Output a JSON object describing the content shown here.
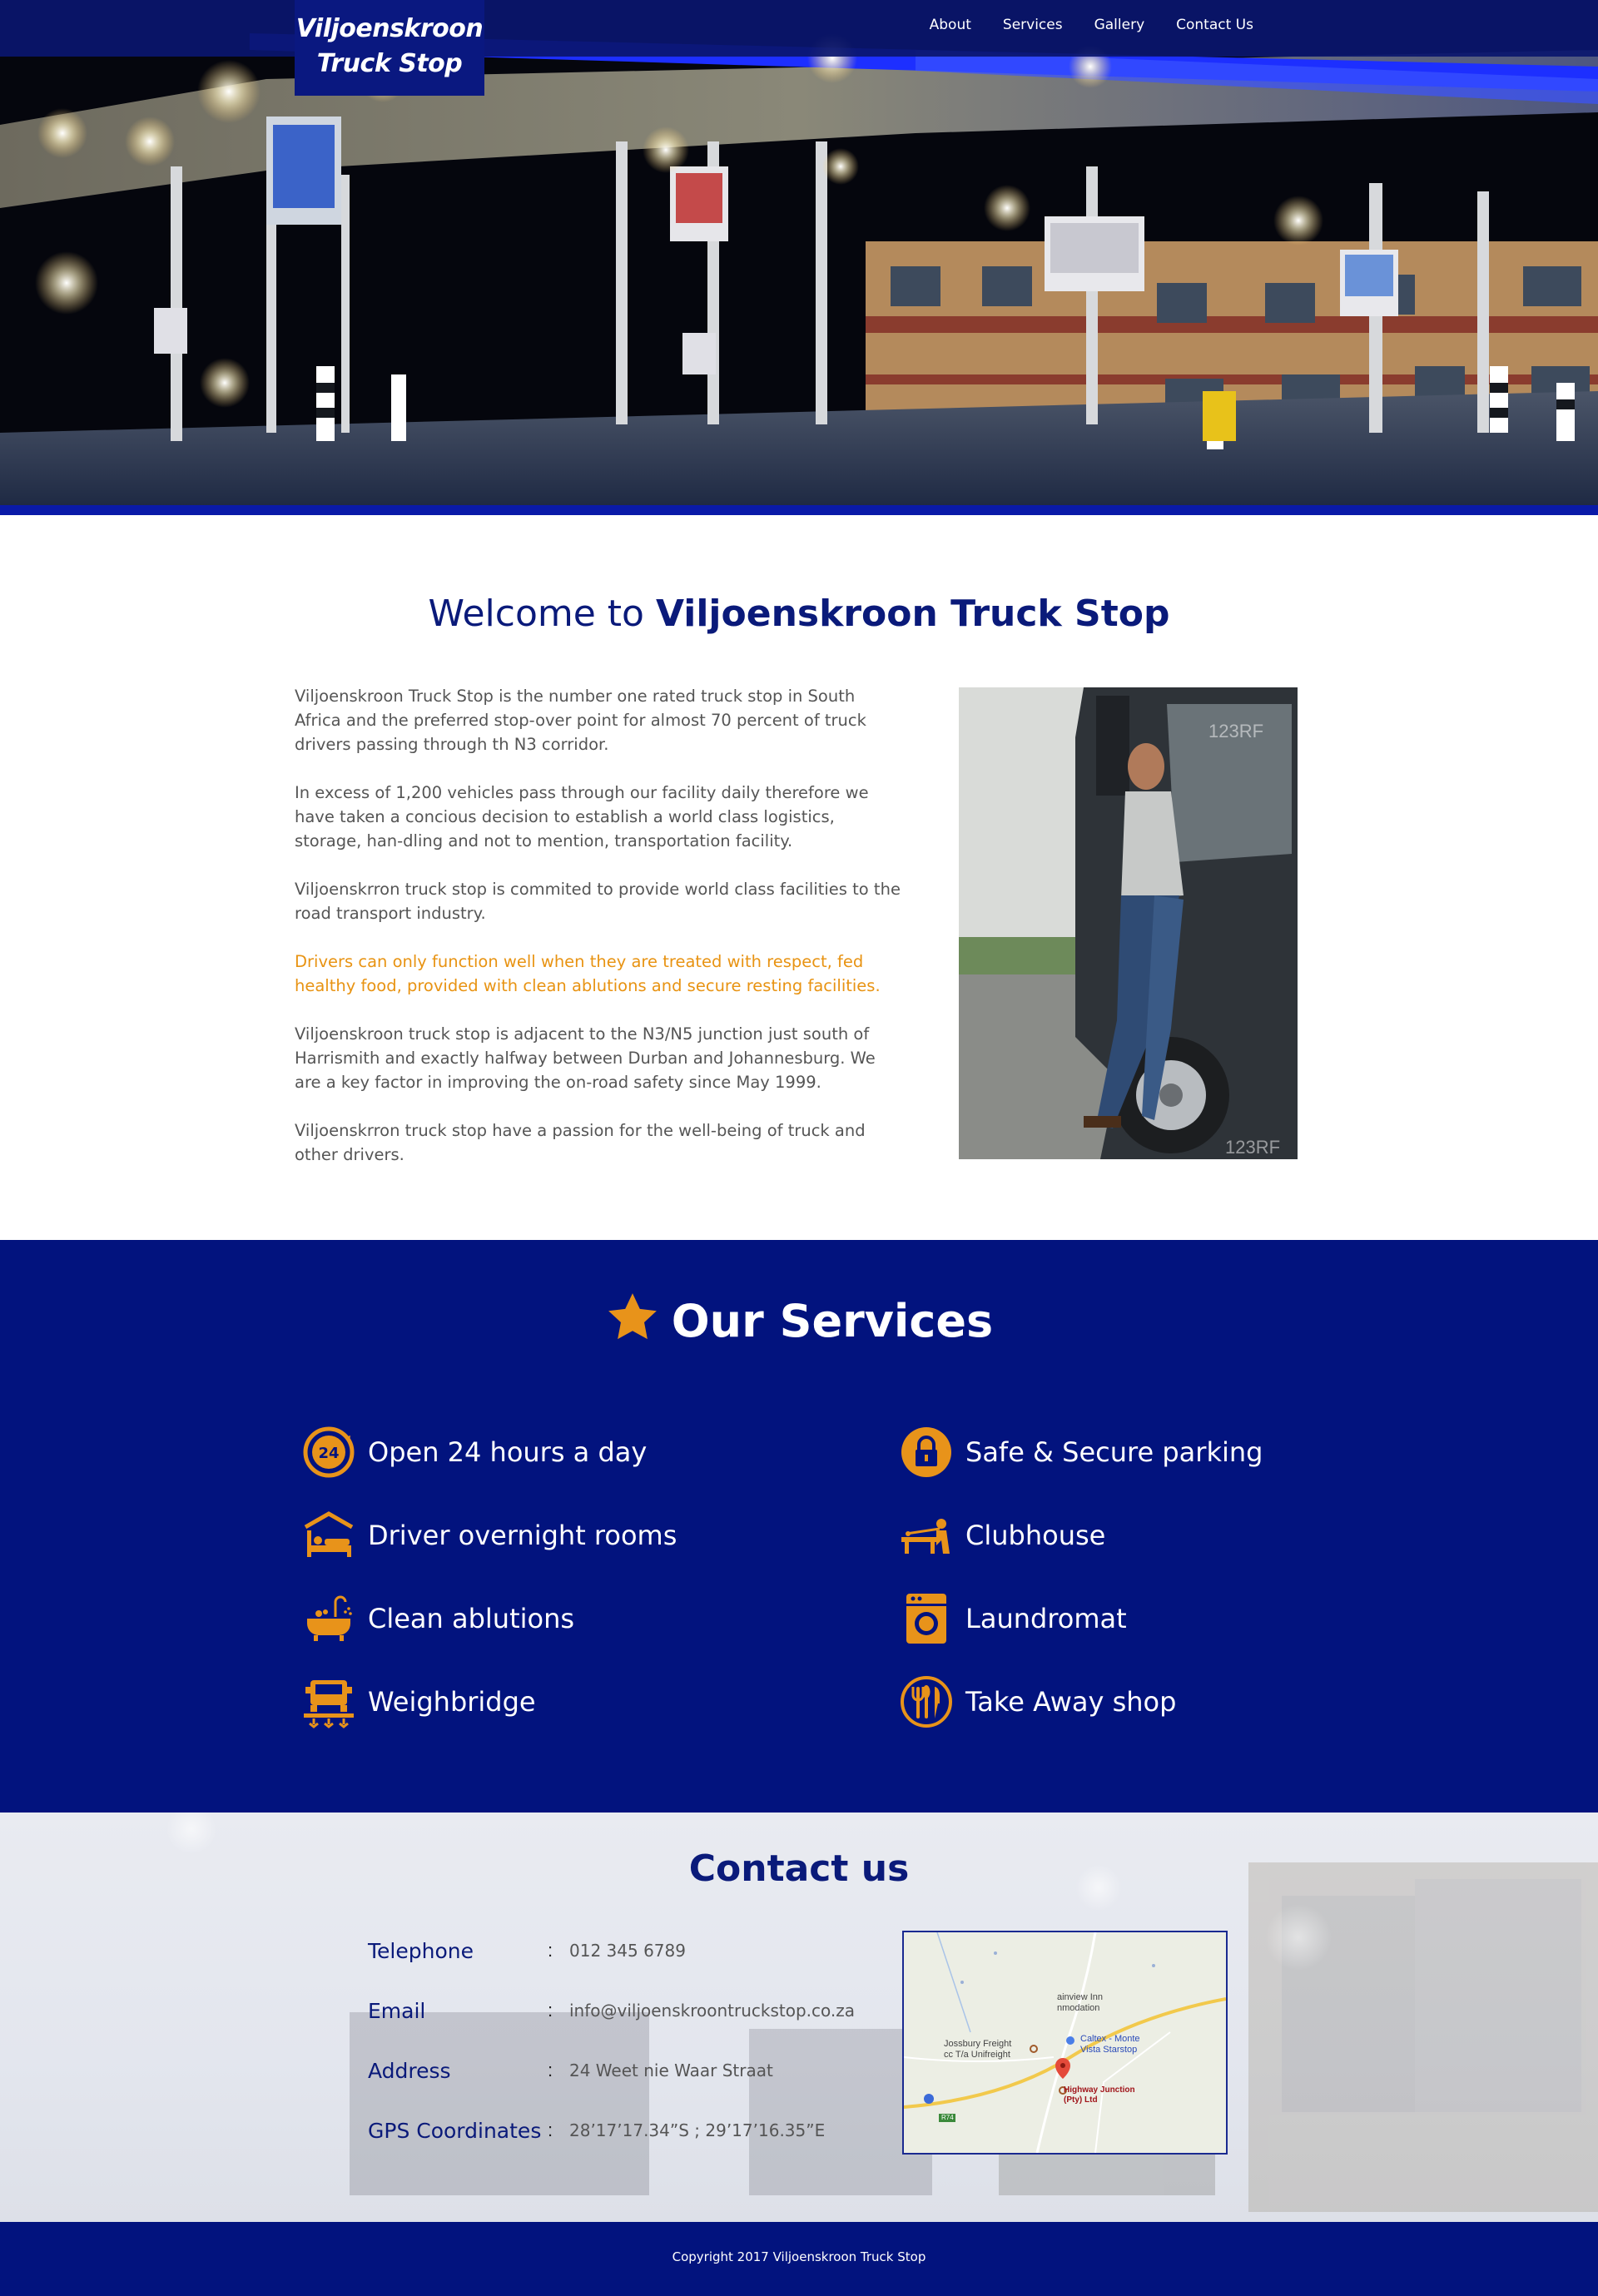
{
  "brand": {
    "line1": "Viljoenskroon",
    "line2": "Truck Stop"
  },
  "nav": {
    "items": [
      "About",
      "Services",
      "Gallery",
      "Contact Us"
    ]
  },
  "welcome": {
    "title_prefix": "Welcome to ",
    "title_bold": "Viljoenskroon Truck Stop",
    "paragraphs": [
      "Viljoenskroon Truck Stop is the number one rated truck stop in South Africa and the preferred stop-over point for almost 70 percent of truck drivers passing through th N3 corridor.",
      "In excess of 1,200 vehicles pass through our facility daily therefore we have taken a concious decision to establish a world class logistics, storage, han-dling and not to mention, transportation facility.",
      "Viljoenskrron truck stop is commited to provide world class facilities to the road transport industry.",
      "Drivers can only function well when they are treated with respect, fed healthy food, provided with clean ablutions and secure resting facilities.",
      "Viljoenskroon truck stop is adjacent to the N3/N5 junction just south of Harrismith and exactly halfway between Durban and Johannesburg. We are a key factor in improving the on-road safety since May 1999.",
      "Viljoenskrron truck stop have a passion for the well-being of truck and other drivers."
    ],
    "photo_watermark": "123RF"
  },
  "services": {
    "title_prefix": "Our ",
    "title_bold": "Services",
    "accent_color": "#e8931a",
    "items": [
      {
        "label": "Open 24 hours a day",
        "icon": "clock-24-icon"
      },
      {
        "label": "Safe & Secure parking",
        "icon": "padlock-icon"
      },
      {
        "label": "Driver overnight rooms",
        "icon": "bed-icon"
      },
      {
        "label": "Clubhouse",
        "icon": "pool-table-icon"
      },
      {
        "label": "Clean ablutions",
        "icon": "bathtub-icon"
      },
      {
        "label": "Laundromat",
        "icon": "washing-machine-icon"
      },
      {
        "label": "Weighbridge",
        "icon": "weighbridge-truck-icon"
      },
      {
        "label": "Take Away shop",
        "icon": "cutlery-icon"
      }
    ]
  },
  "contact": {
    "title_bold": "Contact",
    "title_suffix": " us",
    "separator": ":",
    "rows": [
      {
        "label": "Telephone",
        "value": "012 345 6789"
      },
      {
        "label": "Email",
        "value": "info@viljoenskroontruckstop.co.za"
      },
      {
        "label": "Address",
        "value": "24 Weet nie Waar Straat"
      },
      {
        "label": "GPS Coordinates",
        "value": "28’17’17.34”S ; 29’17’16.35”E"
      }
    ],
    "map": {
      "labels": [
        "ainview Inn",
        "nmodation",
        "Jossbury Freight",
        "cc T/a Unifreight",
        "Caltex - Monte",
        "Vista Starstop",
        "Highway Junction",
        "(Pty) Ltd",
        "R74"
      ]
    }
  },
  "footer": {
    "copyright": "Copyright 2017 Viljoenskroon Truck Stop"
  }
}
